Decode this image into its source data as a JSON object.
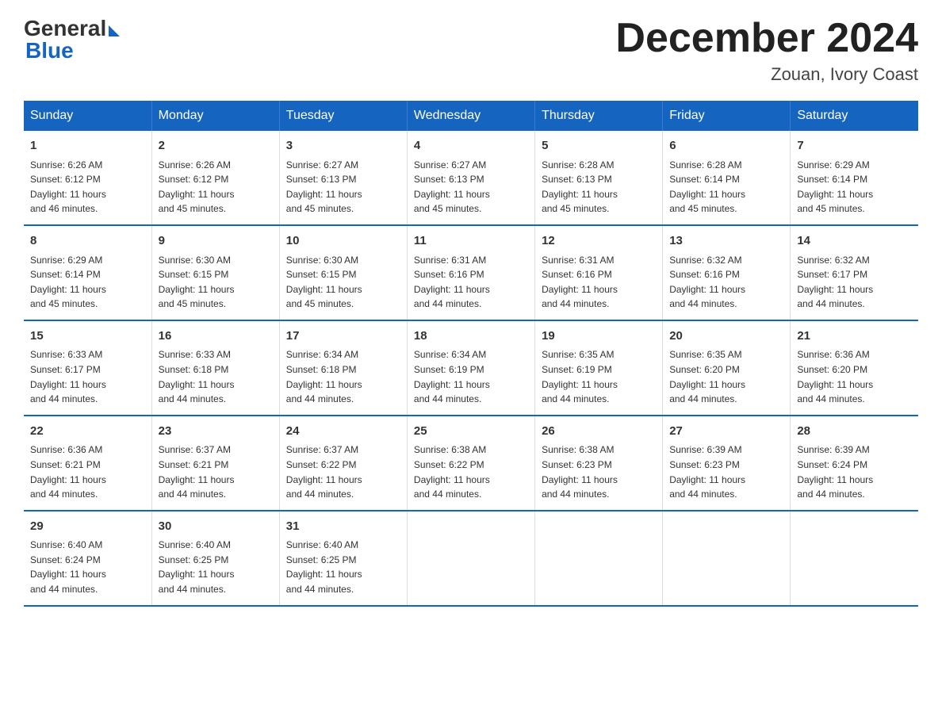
{
  "header": {
    "logo_general": "General",
    "logo_blue": "Blue",
    "month_title": "December 2024",
    "location": "Zouan, Ivory Coast"
  },
  "days_of_week": [
    "Sunday",
    "Monday",
    "Tuesday",
    "Wednesday",
    "Thursday",
    "Friday",
    "Saturday"
  ],
  "weeks": [
    [
      {
        "day": "1",
        "sunrise": "6:26 AM",
        "sunset": "6:12 PM",
        "daylight": "11 hours and 46 minutes."
      },
      {
        "day": "2",
        "sunrise": "6:26 AM",
        "sunset": "6:12 PM",
        "daylight": "11 hours and 45 minutes."
      },
      {
        "day": "3",
        "sunrise": "6:27 AM",
        "sunset": "6:13 PM",
        "daylight": "11 hours and 45 minutes."
      },
      {
        "day": "4",
        "sunrise": "6:27 AM",
        "sunset": "6:13 PM",
        "daylight": "11 hours and 45 minutes."
      },
      {
        "day": "5",
        "sunrise": "6:28 AM",
        "sunset": "6:13 PM",
        "daylight": "11 hours and 45 minutes."
      },
      {
        "day": "6",
        "sunrise": "6:28 AM",
        "sunset": "6:14 PM",
        "daylight": "11 hours and 45 minutes."
      },
      {
        "day": "7",
        "sunrise": "6:29 AM",
        "sunset": "6:14 PM",
        "daylight": "11 hours and 45 minutes."
      }
    ],
    [
      {
        "day": "8",
        "sunrise": "6:29 AM",
        "sunset": "6:14 PM",
        "daylight": "11 hours and 45 minutes."
      },
      {
        "day": "9",
        "sunrise": "6:30 AM",
        "sunset": "6:15 PM",
        "daylight": "11 hours and 45 minutes."
      },
      {
        "day": "10",
        "sunrise": "6:30 AM",
        "sunset": "6:15 PM",
        "daylight": "11 hours and 45 minutes."
      },
      {
        "day": "11",
        "sunrise": "6:31 AM",
        "sunset": "6:16 PM",
        "daylight": "11 hours and 44 minutes."
      },
      {
        "day": "12",
        "sunrise": "6:31 AM",
        "sunset": "6:16 PM",
        "daylight": "11 hours and 44 minutes."
      },
      {
        "day": "13",
        "sunrise": "6:32 AM",
        "sunset": "6:16 PM",
        "daylight": "11 hours and 44 minutes."
      },
      {
        "day": "14",
        "sunrise": "6:32 AM",
        "sunset": "6:17 PM",
        "daylight": "11 hours and 44 minutes."
      }
    ],
    [
      {
        "day": "15",
        "sunrise": "6:33 AM",
        "sunset": "6:17 PM",
        "daylight": "11 hours and 44 minutes."
      },
      {
        "day": "16",
        "sunrise": "6:33 AM",
        "sunset": "6:18 PM",
        "daylight": "11 hours and 44 minutes."
      },
      {
        "day": "17",
        "sunrise": "6:34 AM",
        "sunset": "6:18 PM",
        "daylight": "11 hours and 44 minutes."
      },
      {
        "day": "18",
        "sunrise": "6:34 AM",
        "sunset": "6:19 PM",
        "daylight": "11 hours and 44 minutes."
      },
      {
        "day": "19",
        "sunrise": "6:35 AM",
        "sunset": "6:19 PM",
        "daylight": "11 hours and 44 minutes."
      },
      {
        "day": "20",
        "sunrise": "6:35 AM",
        "sunset": "6:20 PM",
        "daylight": "11 hours and 44 minutes."
      },
      {
        "day": "21",
        "sunrise": "6:36 AM",
        "sunset": "6:20 PM",
        "daylight": "11 hours and 44 minutes."
      }
    ],
    [
      {
        "day": "22",
        "sunrise": "6:36 AM",
        "sunset": "6:21 PM",
        "daylight": "11 hours and 44 minutes."
      },
      {
        "day": "23",
        "sunrise": "6:37 AM",
        "sunset": "6:21 PM",
        "daylight": "11 hours and 44 minutes."
      },
      {
        "day": "24",
        "sunrise": "6:37 AM",
        "sunset": "6:22 PM",
        "daylight": "11 hours and 44 minutes."
      },
      {
        "day": "25",
        "sunrise": "6:38 AM",
        "sunset": "6:22 PM",
        "daylight": "11 hours and 44 minutes."
      },
      {
        "day": "26",
        "sunrise": "6:38 AM",
        "sunset": "6:23 PM",
        "daylight": "11 hours and 44 minutes."
      },
      {
        "day": "27",
        "sunrise": "6:39 AM",
        "sunset": "6:23 PM",
        "daylight": "11 hours and 44 minutes."
      },
      {
        "day": "28",
        "sunrise": "6:39 AM",
        "sunset": "6:24 PM",
        "daylight": "11 hours and 44 minutes."
      }
    ],
    [
      {
        "day": "29",
        "sunrise": "6:40 AM",
        "sunset": "6:24 PM",
        "daylight": "11 hours and 44 minutes."
      },
      {
        "day": "30",
        "sunrise": "6:40 AM",
        "sunset": "6:25 PM",
        "daylight": "11 hours and 44 minutes."
      },
      {
        "day": "31",
        "sunrise": "6:40 AM",
        "sunset": "6:25 PM",
        "daylight": "11 hours and 44 minutes."
      },
      null,
      null,
      null,
      null
    ]
  ],
  "labels": {
    "sunrise": "Sunrise:",
    "sunset": "Sunset:",
    "daylight": "Daylight:"
  }
}
